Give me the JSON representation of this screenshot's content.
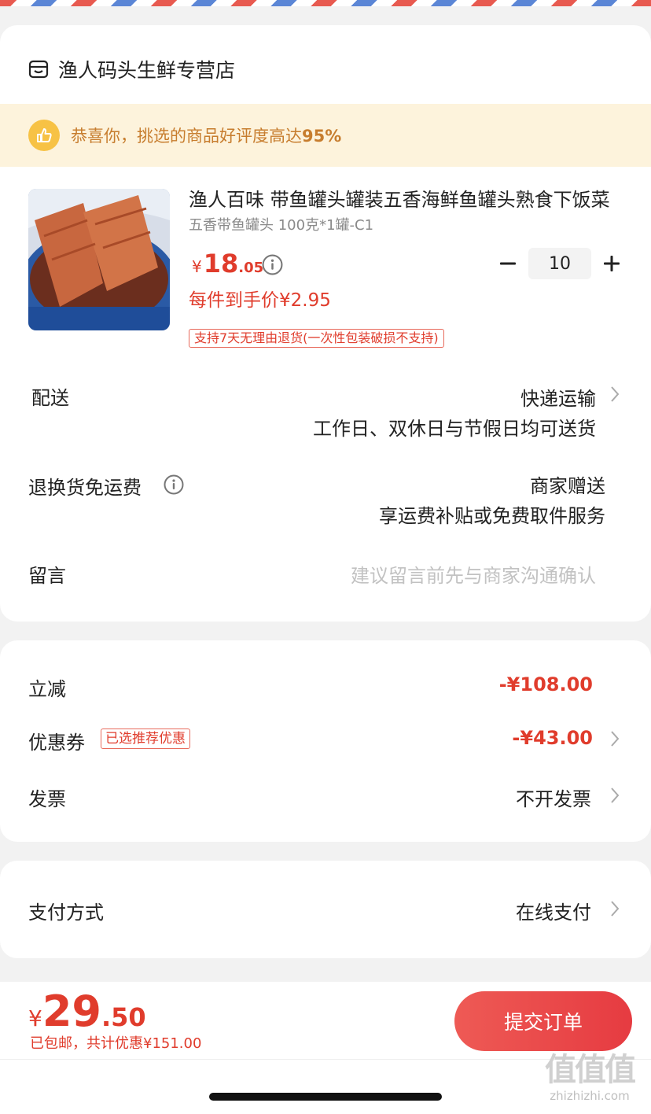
{
  "shop": {
    "name": "渔人码头生鲜专营店",
    "icon": "store-icon"
  },
  "praise": {
    "text_prefix": "恭喜你，挑选的商品好评度高达",
    "percent": "95%",
    "icon": "thumbs-up-icon"
  },
  "product": {
    "title": "渔人百味 带鱼罐头罐装五香海鲜鱼罐头熟食下饭菜",
    "sku": "五香带鱼罐头 100克*1罐-C1",
    "price_symbol": "¥",
    "price_int": "18",
    "price_dec": ".05",
    "unit_price_text": "每件到手价¥2.95",
    "quantity": "10",
    "return_policy": "支持7天无理由退货(一次性包装破损不支持)"
  },
  "delivery": {
    "label": "配送",
    "method": "快递运输",
    "note": "工作日、双休日与节假日均可送货"
  },
  "return_shipping": {
    "label": "退换货免运费",
    "value": "商家赠送",
    "note": "享运费补贴或免费取件服务"
  },
  "message": {
    "label": "留言",
    "placeholder": "建议留言前先与商家沟通确认"
  },
  "discounts": {
    "instant": {
      "label": "立减",
      "value": "-¥108.00"
    },
    "coupon": {
      "label": "优惠券",
      "tag": "已选推荐优惠",
      "value": "-¥43.00"
    },
    "invoice": {
      "label": "发票",
      "value": "不开发票"
    }
  },
  "payment": {
    "label": "支付方式",
    "value": "在线支付"
  },
  "footer": {
    "total_symbol": "¥",
    "total_int": "29",
    "total_dec": ".50",
    "note": "已包邮，共计优惠¥151.00",
    "submit_label": "提交订单"
  },
  "watermark": {
    "logo": "值值值",
    "url": "zhizhizhi.com"
  },
  "colors": {
    "accent": "#e03c2c",
    "praise_bg": "#fdf3dc",
    "praise_text": "#c77d2e"
  }
}
